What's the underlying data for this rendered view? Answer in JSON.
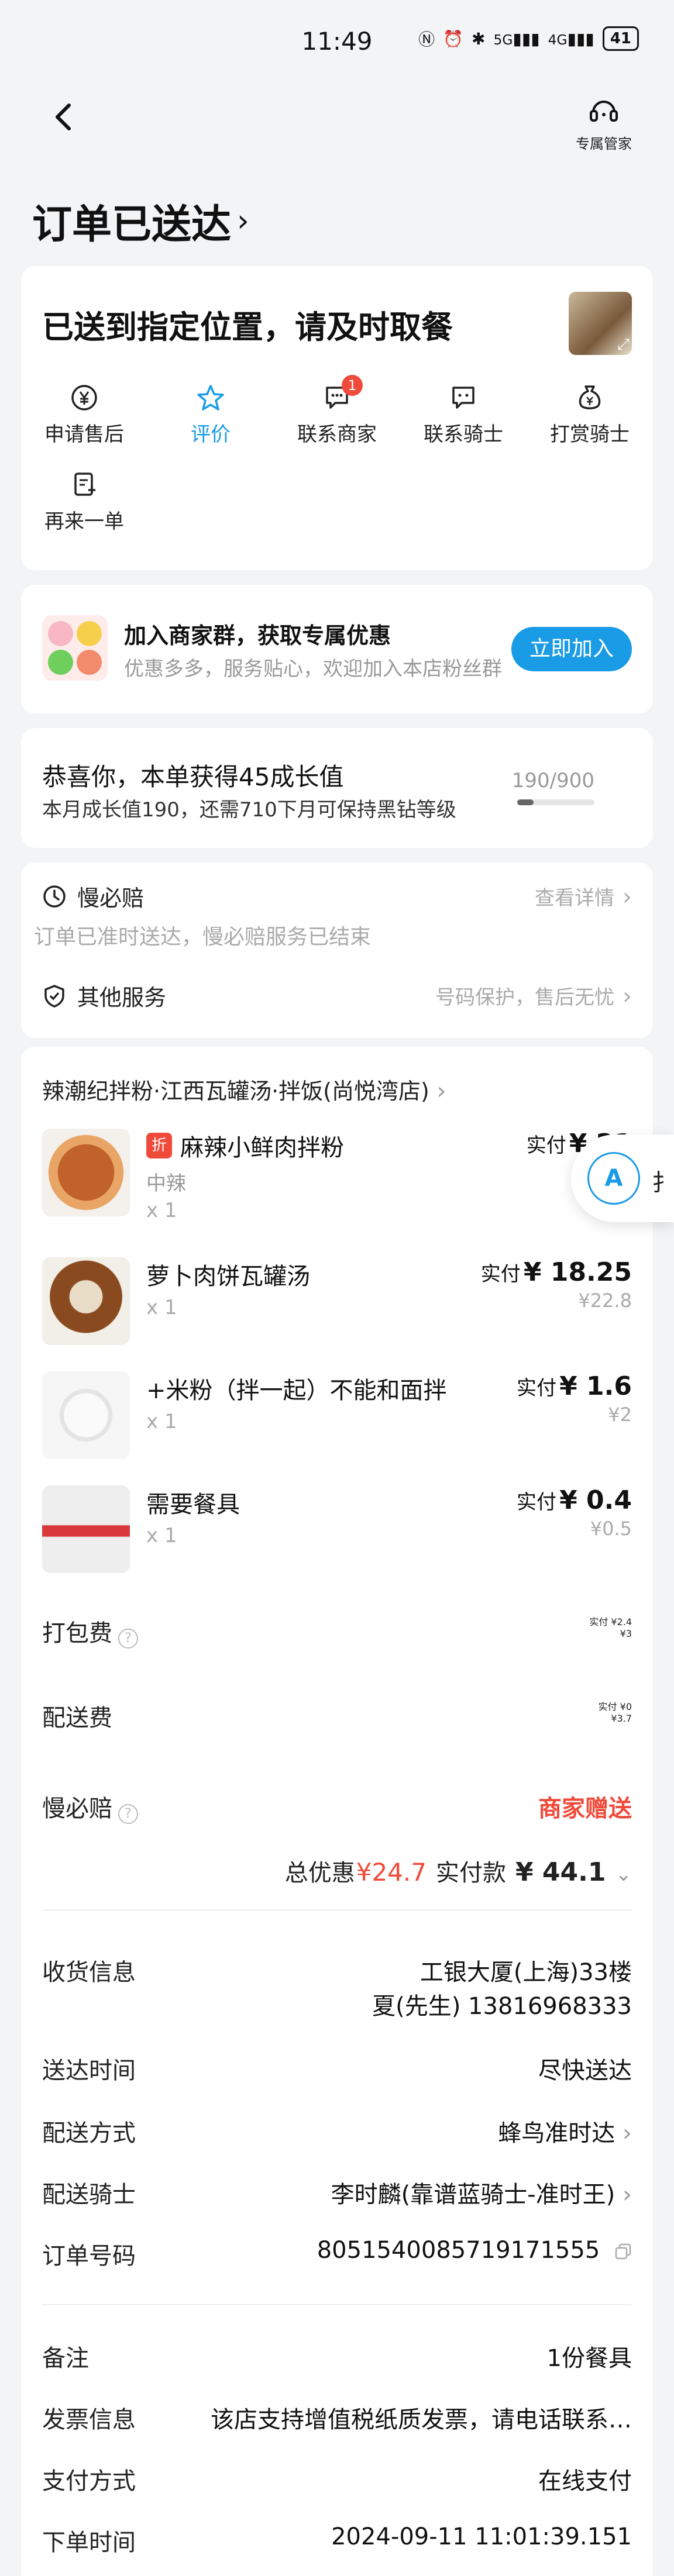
{
  "status_bar": {
    "time": "11:49",
    "battery": "41",
    "signal_5g": "5G",
    "signal_4g": "4G"
  },
  "nav": {
    "butler_label": "专属管家"
  },
  "page_title": "订单已送达",
  "status_card": {
    "headline": "已送到指定位置，请及时取餐",
    "actions": [
      {
        "label": "申请售后",
        "icon": "yen-circle-icon"
      },
      {
        "label": "评价",
        "icon": "star-icon",
        "active": true
      },
      {
        "label": "联系商家",
        "icon": "chat-icon",
        "badge": "1"
      },
      {
        "label": "联系骑士",
        "icon": "chat-icon"
      },
      {
        "label": "打赏骑士",
        "icon": "money-bag-icon"
      },
      {
        "label": "再来一单",
        "icon": "reorder-icon"
      }
    ]
  },
  "group_card": {
    "title": "加入商家群，获取专属优惠",
    "subtitle": "优惠多多，服务贴心，欢迎加入本店粉丝群",
    "button": "立即加入"
  },
  "growth_card": {
    "line1": "恭喜你，本单获得45成长值",
    "line2": "本月成长值190，还需710下月可保持黑钻等级",
    "count": "190/900",
    "progress": 0.21
  },
  "services": {
    "slow_title": "慢必赔",
    "slow_link": "查看详情",
    "slow_desc": "订单已准时送达，慢必赔服务已结束",
    "other_title": "其他服务",
    "other_value": "号码保护，售后无忧"
  },
  "order": {
    "shop_name": "辣潮纪拌粉·江西瓦罐汤·拌饭(尚悦湾店)",
    "price_label": "实付",
    "items": [
      {
        "tag": "折",
        "name": "麻辣小鲜肉拌粉",
        "spec": "中辣",
        "qty": "x 1",
        "price": "¥ 21",
        "original": ""
      },
      {
        "tag": "",
        "name": "萝卜肉饼瓦罐汤",
        "spec": "",
        "qty": "x 1",
        "price": "¥ 18.25",
        "original": "¥22.8"
      },
      {
        "tag": "",
        "name": "+米粉（拌一起）不能和面拌",
        "spec": "",
        "qty": "x 1",
        "price": "¥ 1.6",
        "original": "¥2"
      },
      {
        "tag": "",
        "name": "需要餐具",
        "spec": "",
        "qty": "x 1",
        "price": "¥ 0.4",
        "original": "¥0.5"
      }
    ],
    "fees": [
      {
        "label": "打包费",
        "help": true,
        "price": "¥2.4",
        "original": "¥3"
      },
      {
        "label": "配送费",
        "help": false,
        "price": "¥0",
        "original": "¥3.7"
      }
    ],
    "slow_pay": {
      "label": "慢必赔",
      "value": "商家赠送"
    },
    "totals": {
      "discount_label": "总优惠",
      "discount": "¥24.7",
      "paid_label": "实付款",
      "paid": "¥ 44.1"
    }
  },
  "delivery": {
    "address_label": "收货信息",
    "address_line1": "工银大厦(上海)33楼",
    "address_line2": "夏(先生) 13816968333",
    "time_label": "送达时间",
    "time_value": "尽快送达",
    "method_label": "配送方式",
    "method_value": "蜂鸟准时达",
    "rider_label": "配送骑士",
    "rider_value": "李时麟(靠谱蓝骑士-准时王)",
    "order_no_label": "订单号码",
    "order_no_value": "8051540085719171555",
    "note_label": "备注",
    "note_value": "1份餐具",
    "invoice_label": "发票信息",
    "invoice_value": "该店支持增值税纸质发票，请电话联系…",
    "pay_label": "支付方式",
    "pay_value": "在线支付",
    "order_time_label": "下单时间",
    "order_time_value": "2024-09-11 11:01:39.151"
  },
  "floating": {
    "icon_letter": "A",
    "text": "扌"
  },
  "colors": {
    "accent": "#1a9be6",
    "red": "#f04a3a",
    "background": "#f3f4f6"
  }
}
